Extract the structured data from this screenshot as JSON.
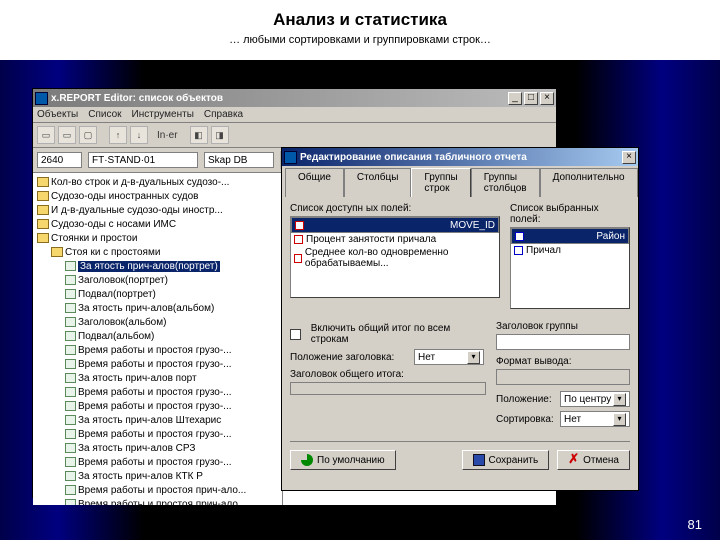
{
  "slide": {
    "title": "Анализ и статистика",
    "subtitle": "… любыми сортировками и группировками строк…",
    "page": "81"
  },
  "mainwin": {
    "title": "x.REPORT Editor: список объектов",
    "menu": [
      "Объекты",
      "Список",
      "Инструменты",
      "Справка"
    ],
    "toolbar_label": "In·er",
    "addr": {
      "f1": "2640",
      "f2": "FT·STAND·01",
      "f3": "Skap DB"
    },
    "min": "_",
    "max": "□",
    "close": "×",
    "tree": [
      {
        "d": 0,
        "t": "fold",
        "l": "Кол-во строк и д-в-дуальных судозо-..."
      },
      {
        "d": 0,
        "t": "fold",
        "l": "Судозо-оды иностранных судов"
      },
      {
        "d": 0,
        "t": "fold",
        "l": "И д-в-дуальные судозо-оды иностр..."
      },
      {
        "d": 0,
        "t": "fold",
        "l": "Судозо-оды с носами ИМС"
      },
      {
        "d": 0,
        "t": "open",
        "l": "Стоянки и простои"
      },
      {
        "d": 1,
        "t": "open",
        "l": "Стоя ки с простоями"
      },
      {
        "d": 2,
        "t": "sel",
        "l": "За ятость прич-алов(портрет)"
      },
      {
        "d": 2,
        "t": "file",
        "l": "Заголовок(портрет)"
      },
      {
        "d": 2,
        "t": "file",
        "l": "Подвал(портрет)"
      },
      {
        "d": 2,
        "t": "file",
        "l": "За ятость прич-алов(альбом)"
      },
      {
        "d": 2,
        "t": "file",
        "l": "Заголовок(альбом)"
      },
      {
        "d": 2,
        "t": "file",
        "l": "Подвал(альбом)"
      },
      {
        "d": 2,
        "t": "file",
        "l": "Время работы и простоя грузо-..."
      },
      {
        "d": 2,
        "t": "file",
        "l": "Время работы и простоя грузо-..."
      },
      {
        "d": 2,
        "t": "file",
        "l": "За ятость прич-алов  порт"
      },
      {
        "d": 2,
        "t": "file",
        "l": "Время работы и простоя грузо-..."
      },
      {
        "d": 2,
        "t": "file",
        "l": "Время работы и простоя грузо-..."
      },
      {
        "d": 2,
        "t": "file",
        "l": "За ятость прич-алов  Штехарис"
      },
      {
        "d": 2,
        "t": "file",
        "l": "Время работы и простоя грузо-..."
      },
      {
        "d": 2,
        "t": "file",
        "l": "За ятость прич-алов  СРЗ"
      },
      {
        "d": 2,
        "t": "file",
        "l": "Время работы и простоя грузо-..."
      },
      {
        "d": 2,
        "t": "file",
        "l": "За ятость прич-алов КТК Р"
      },
      {
        "d": 2,
        "t": "file",
        "l": "Время работы и простоя прич-ало..."
      },
      {
        "d": 2,
        "t": "file",
        "l": "Время работы и простоя прич-ало..."
      }
    ]
  },
  "dialog": {
    "title": "Редактирование описания табличного отчета",
    "close": "×",
    "tabs": [
      "Общие",
      "Столбцы",
      "Группы строк",
      "Группы столбцов",
      "Дополнительно"
    ],
    "active_tab": 2,
    "left": {
      "label": "Список доступн ых полей:",
      "items": [
        "MOVE_ID",
        "Процент занятости причала",
        "Среднее кол-во одновременно обрабатываемы..."
      ]
    },
    "right": {
      "label": "Список выбранных полей:",
      "items": [
        "Район",
        "Причал"
      ]
    },
    "chk_label": "Включить общий итог по всем строкам",
    "rows": {
      "r1": "Положение заголовка:",
      "r1v": "Нет",
      "r2": "Заголовок общего итога:",
      "g_label": "Заголовок группы",
      "r3": "Формат вывода:",
      "r4": "Положение:",
      "r4v": "По центру",
      "r5": "Сортировка:",
      "r5v": "Нет"
    },
    "btns": {
      "def": "По умолчанию",
      "save": "Сохранить",
      "cancel": "Отмена"
    }
  }
}
